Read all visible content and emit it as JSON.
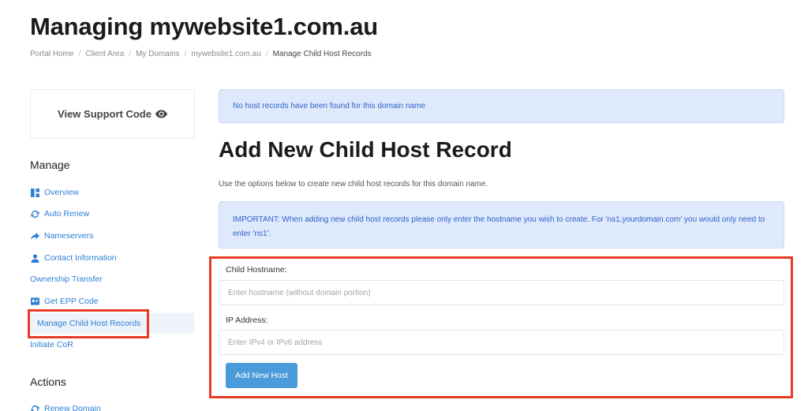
{
  "page": {
    "title": "Managing mywebsite1.com.au"
  },
  "breadcrumb": [
    "Portal Home",
    "Client Area",
    "My Domains",
    "mywebsite1.com.au",
    "Manage Child Host Records"
  ],
  "sidebar": {
    "support_label": "View Support Code",
    "manage_heading": "Manage",
    "items": [
      {
        "label": "Overview",
        "icon": "overview-icon"
      },
      {
        "label": "Auto Renew",
        "icon": "sync-icon"
      },
      {
        "label": "Nameservers",
        "icon": "share-arrow-icon"
      },
      {
        "label": "Contact Information",
        "icon": "user-icon"
      },
      {
        "label": "Ownership Transfer",
        "icon": ""
      },
      {
        "label": "Get EPP Code",
        "icon": "id-card-icon"
      },
      {
        "label": "Manage Child Host Records",
        "icon": "",
        "active": true
      },
      {
        "label": "Initiate CoR",
        "icon": ""
      }
    ],
    "actions_heading": "Actions",
    "actions": [
      {
        "label": "Renew Domain",
        "icon": "sync-icon"
      }
    ]
  },
  "main": {
    "alert_no_records": "No host records have been found for this domain name",
    "heading": "Add New Child Host Record",
    "description": "Use the options below to create new child host records for this domain name.",
    "important_text": "IMPORTANT: When adding new child host records please only enter the hostname you wish to create. For 'ns1.yourdomain.com' you would only need to enter 'ns1'.",
    "hostname_label": "Child Hostname:",
    "hostname_placeholder": "Enter hostname (without domain portion)",
    "hostname_value": "",
    "ip_label": "IP Address:",
    "ip_placeholder": "Enter IPv4 or IPv6 address",
    "ip_value": "",
    "submit_label": "Add New Host"
  },
  "colors": {
    "link": "#2b7fd4",
    "alert_bg": "#dfe9fc",
    "alert_text": "#2d62c8",
    "button": "#4a9bd9",
    "highlight": "#e63b24"
  }
}
